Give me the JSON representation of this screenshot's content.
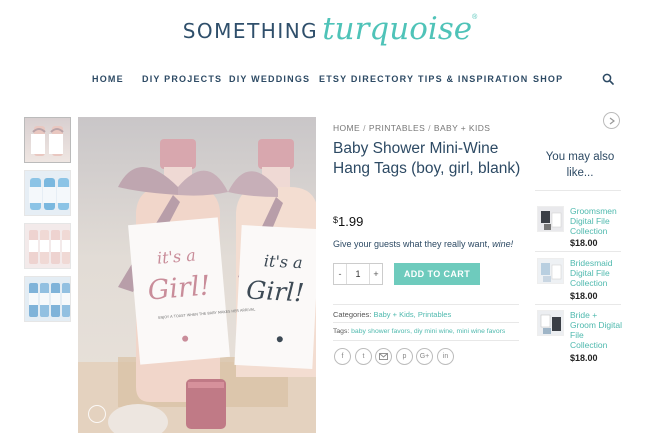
{
  "brand": {
    "logo_word1": "SOMETHING",
    "logo_word2": "turquoise",
    "accent": "#4fc3b8",
    "navy": "#2d4a64"
  },
  "nav": {
    "items": [
      "HOME",
      "DIY PROJECTS",
      "DIY WEDDINGS",
      "ETSY DIRECTORY",
      "TIPS & INSPIRATION",
      "SHOP"
    ],
    "search_icon": "search-icon"
  },
  "gallery": {
    "thumb_count": 4
  },
  "product": {
    "breadcrumb": [
      "HOME",
      "PRINTABLES",
      "BABY + KIDS"
    ],
    "title": "Baby Shower Mini-Wine Hang Tags (boy, girl, blank)",
    "price_currency": "$",
    "price_amount": "1.99",
    "description": "Give your guests what they really want,",
    "description_emphasis": "wine!",
    "quantity": "1",
    "qty_minus": "-",
    "qty_plus": "+",
    "add_to_cart": "ADD TO CART",
    "categories_label": "Categories:",
    "categories": "Baby + Kids, Printables",
    "tags_label": "Tags:",
    "tags": "baby shower favors, diy mini wine, mini wine favors",
    "share_icons": [
      "facebook-icon",
      "twitter-icon",
      "email-icon",
      "pinterest-icon",
      "google-plus-icon",
      "linkedin-icon"
    ],
    "tag_text_1": "it's a",
    "tag_text_2": "Girl!",
    "tag_small": "ENJOY A TOAST WHEN THE BABY MAKES HER ARRIVAL"
  },
  "sidebar": {
    "title": "You may also like...",
    "items": [
      {
        "name": "Groomsmen Digital File Collection",
        "price": "$18.00"
      },
      {
        "name": "Bridesmaid Digital File Collection",
        "price": "$18.00"
      },
      {
        "name": "Bride + Groom Digital File Collection",
        "price": "$18.00"
      }
    ]
  }
}
